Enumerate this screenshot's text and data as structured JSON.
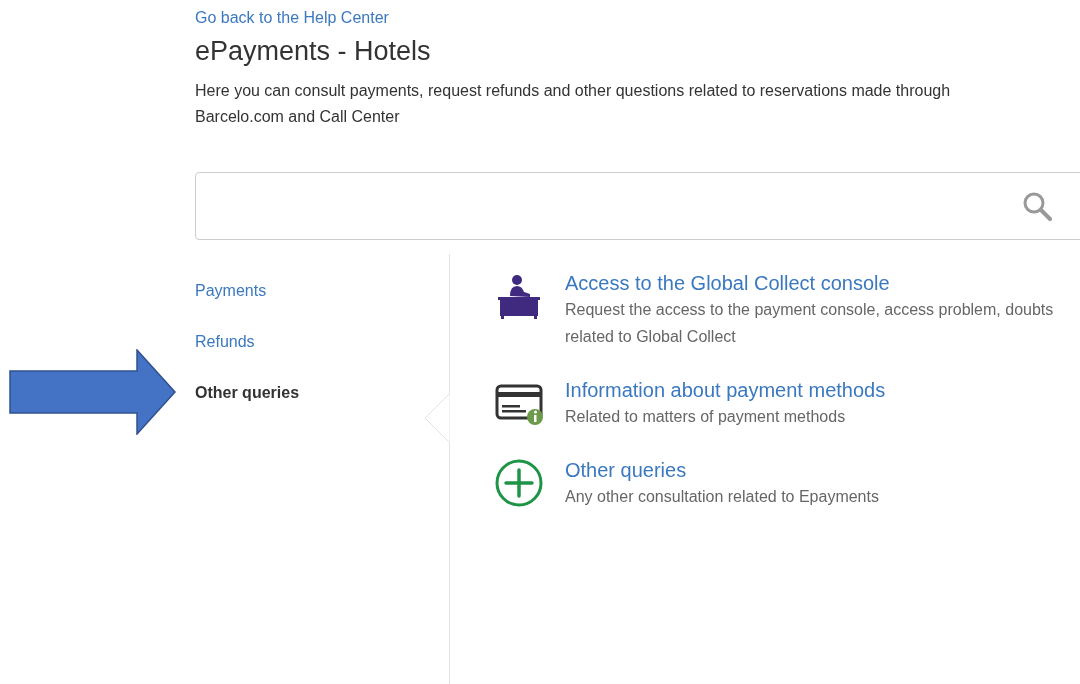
{
  "back_link": "Go back to the Help Center",
  "title": "ePayments - Hotels",
  "intro": "Here you can consult payments, request refunds and other questions related to reservations made through Barcelo.com and Call Center",
  "sidebar": {
    "items": [
      {
        "label": "Payments",
        "selected": false
      },
      {
        "label": "Refunds",
        "selected": false
      },
      {
        "label": "Other queries",
        "selected": true
      }
    ]
  },
  "topics": [
    {
      "kind": "desk",
      "title": "Access to the Global Collect console",
      "description": "Request the access to the payment console, access problem, doubts related to Global Collect"
    },
    {
      "kind": "card",
      "title": "Information about payment methods",
      "description": "Related to matters of payment methods"
    },
    {
      "kind": "plus",
      "title": "Other queries",
      "description": "Any other consultation related to Epayments"
    }
  ],
  "annotation": {
    "kind": "arrow"
  }
}
